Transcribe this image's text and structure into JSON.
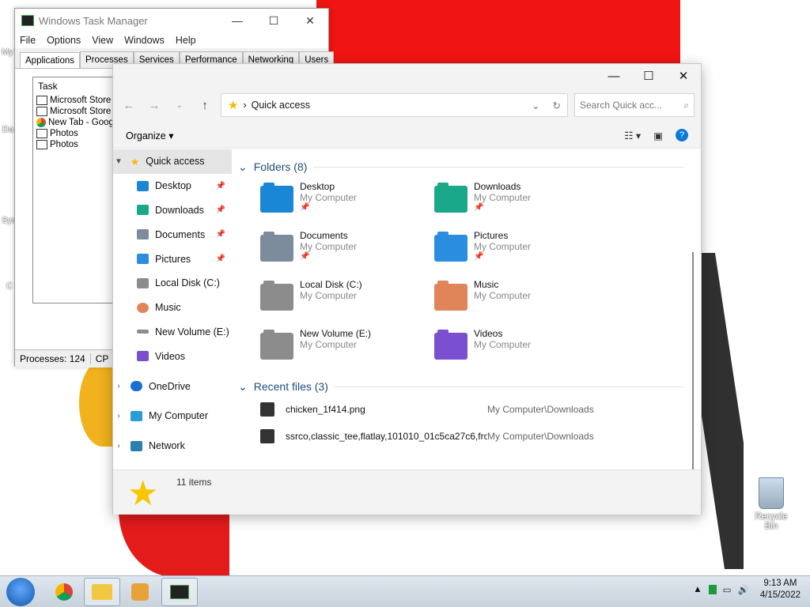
{
  "desktop": {
    "labels": [
      "My",
      "Da",
      "Sys",
      "C"
    ],
    "recycle_bin": "Recycle Bin"
  },
  "task_manager": {
    "title": "Windows Task Manager",
    "menu": [
      "File",
      "Options",
      "View",
      "Windows",
      "Help"
    ],
    "tabs": [
      "Applications",
      "Processes",
      "Services",
      "Performance",
      "Networking",
      "Users"
    ],
    "list_header": "Task",
    "tasks": [
      "Microsoft Store",
      "Microsoft Store",
      "New Tab - Goog",
      "Photos",
      "Photos"
    ],
    "status": [
      "Processes: 124",
      "CP"
    ]
  },
  "explorer": {
    "address": "Quick access",
    "search_placeholder": "Search Quick acc...",
    "organize": "Organize",
    "sidebar": [
      {
        "label": "Quick access",
        "expandable": true,
        "pinned": false
      },
      {
        "label": "Desktop",
        "pinned": true
      },
      {
        "label": "Downloads",
        "pinned": true
      },
      {
        "label": "Documents",
        "pinned": true
      },
      {
        "label": "Pictures",
        "pinned": true
      },
      {
        "label": "Local Disk (C:)",
        "pinned": false
      },
      {
        "label": "Music",
        "pinned": false
      },
      {
        "label": "New Volume (E:)",
        "pinned": false
      },
      {
        "label": "Videos",
        "pinned": false
      },
      {
        "label": "OneDrive",
        "expandable": true
      },
      {
        "label": "My Computer",
        "expandable": true
      },
      {
        "label": "Network",
        "expandable": true
      }
    ],
    "folders_header": "Folders (8)",
    "folders": [
      {
        "name": "Desktop",
        "location": "My Computer",
        "pinned": true,
        "color": "#1a86d6"
      },
      {
        "name": "Downloads",
        "location": "My Computer",
        "pinned": true,
        "color": "#1aa88a"
      },
      {
        "name": "Documents",
        "location": "My Computer",
        "pinned": true,
        "color": "#7c8c9c"
      },
      {
        "name": "Pictures",
        "location": "My Computer",
        "pinned": true,
        "color": "#2a8de0"
      },
      {
        "name": "Local Disk (C:)",
        "location": "My Computer",
        "pinned": false,
        "color": "#8c8c8c"
      },
      {
        "name": "Music",
        "location": "My Computer",
        "pinned": false,
        "color": "#e0855a"
      },
      {
        "name": "New Volume (E:)",
        "location": "My Computer",
        "pinned": false,
        "color": "#8c8c8c"
      },
      {
        "name": "Videos",
        "location": "My Computer",
        "pinned": false,
        "color": "#7a4fd0"
      }
    ],
    "recent_header": "Recent files (3)",
    "recent_files": [
      {
        "name": "chicken_1f414.png",
        "location": "My Computer\\Downloads"
      },
      {
        "name": "ssrco,classic_tee,flatlay,101010_01c5ca27c6,fro...",
        "location": "My Computer\\Downloads"
      }
    ],
    "status_items": "11 items"
  },
  "taskbar": {
    "time": "9:13 AM",
    "date": "4/15/2022"
  }
}
